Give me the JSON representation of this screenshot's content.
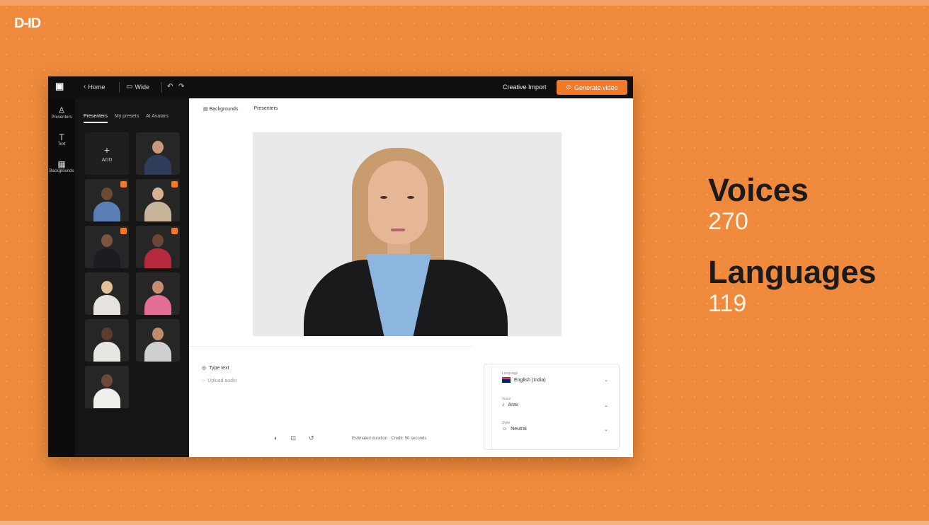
{
  "brand": {
    "logo_text": "D-ID",
    "accent": "#f07a2a",
    "background": "#ef8a3c"
  },
  "stats": [
    {
      "label": "Voices",
      "value": "270"
    },
    {
      "label": "Languages",
      "value": "119"
    }
  ],
  "app": {
    "topbar": {
      "home_label": "Home",
      "size_label": "Wide",
      "creative_label": "Creative Import",
      "generate_label": "Generate video"
    },
    "iconbar": [
      {
        "icon": "presenter-icon",
        "label": "Presenters"
      },
      {
        "icon": "text-icon",
        "label": "Text"
      },
      {
        "icon": "background-icon",
        "label": "Backgrounds"
      }
    ],
    "sidebar": {
      "tabs": [
        "Presenters",
        "My presets",
        "AI Avatars"
      ],
      "add_label": "ADD"
    },
    "main": {
      "tabs": [
        "Backgrounds",
        "Presenters"
      ],
      "type_text_label": "Type text",
      "upload_label": "Upload audio",
      "cost_label": "Estimated duration · Credit: 50 seconds"
    },
    "voice": {
      "language_label": "Language",
      "language_value": "English (India)",
      "voice_label": "Voice",
      "voice_value": "Arav",
      "style_label": "Style",
      "style_value": "Neutral"
    }
  }
}
